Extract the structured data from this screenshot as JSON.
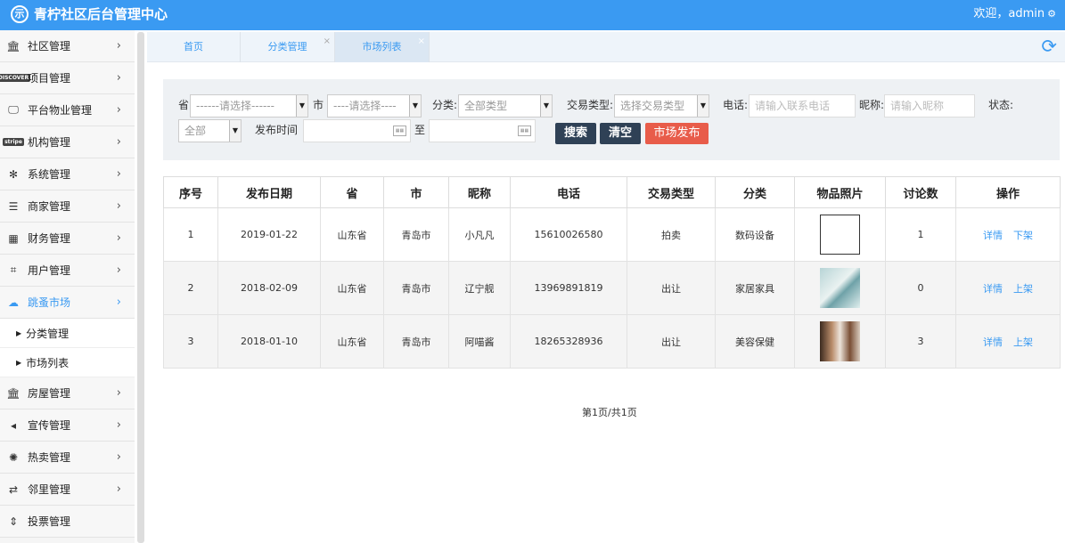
{
  "header": {
    "logo_glyph": "示",
    "title": "青柠社区后台管理中心",
    "welcome": "欢迎，admin",
    "settings_icon": "gear-icon"
  },
  "sidebar": {
    "items": [
      {
        "label": "社区管理",
        "icon": "bank-icon",
        "glyph": "🏛"
      },
      {
        "label": "项目管理",
        "icon": "discover-card-icon",
        "glyph": "DISCOVER"
      },
      {
        "label": "平台物业管理",
        "icon": "monitor-icon",
        "glyph": "🖵"
      },
      {
        "label": "机构管理",
        "icon": "stripe-icon",
        "glyph": "stripe"
      },
      {
        "label": "系统管理",
        "icon": "yelp-icon",
        "glyph": "✻"
      },
      {
        "label": "商家管理",
        "icon": "menu-icon",
        "glyph": "☰"
      },
      {
        "label": "财务管理",
        "icon": "calculator-icon",
        "glyph": "▦"
      },
      {
        "label": "用户管理",
        "icon": "crop-icon",
        "glyph": "⌗"
      },
      {
        "label": "跳蚤市场",
        "icon": "cloud-icon",
        "glyph": "☁",
        "active": true
      },
      {
        "label": "房屋管理",
        "icon": "bank-icon",
        "glyph": "🏛"
      },
      {
        "label": "宣传管理",
        "icon": "volume-icon",
        "glyph": "◂"
      },
      {
        "label": "热卖管理",
        "icon": "sun-icon",
        "glyph": "✺"
      },
      {
        "label": "邻里管理",
        "icon": "retweet-icon",
        "glyph": "⇄"
      },
      {
        "label": "投票管理",
        "icon": "sort-icon",
        "glyph": "⇕"
      }
    ],
    "subitems": [
      {
        "label": "分类管理"
      },
      {
        "label": "市场列表"
      }
    ],
    "accent": "#3a9af2"
  },
  "tabs": [
    {
      "label": "首页",
      "closable": false
    },
    {
      "label": "分类管理",
      "closable": true
    },
    {
      "label": "市场列表",
      "closable": true,
      "active": true
    }
  ],
  "filter": {
    "province_label": "省",
    "province_value": "------请选择------",
    "city_label": "市",
    "city_value": "----请选择----",
    "category_label": "分类:",
    "category_value": "全部类型",
    "trade_label": "交易类型:",
    "trade_value": "选择交易类型",
    "phone_label": "电话:",
    "phone_placeholder": "请输入联系电话",
    "nickname_label": "昵称:",
    "nickname_placeholder": "请输入昵称",
    "status_label": "状态:",
    "status_value": "全部",
    "date_label": "发布时间",
    "date_to": "至",
    "search_btn": "搜索",
    "clear_btn": "清空",
    "publish_btn": "市场发布"
  },
  "table": {
    "columns": [
      "序号",
      "发布日期",
      "省",
      "市",
      "昵称",
      "电话",
      "交易类型",
      "分类",
      "物品照片",
      "讨论数",
      "操作"
    ],
    "rows": [
      {
        "no": "1",
        "date": "2019-01-22",
        "province": "山东省",
        "city": "青岛市",
        "nickname": "小凡凡",
        "phone": "15610026580",
        "trade": "拍卖",
        "category": "数码设备",
        "comments": "1",
        "detail": "详情",
        "toggle": "下架"
      },
      {
        "no": "2",
        "date": "2018-02-09",
        "province": "山东省",
        "city": "青岛市",
        "nickname": "辽宁舰",
        "phone": "13969891819",
        "trade": "出让",
        "category": "家居家具",
        "comments": "0",
        "detail": "详情",
        "toggle": "上架"
      },
      {
        "no": "3",
        "date": "2018-01-10",
        "province": "山东省",
        "city": "青岛市",
        "nickname": "阿喵酱",
        "phone": "18265328936",
        "trade": "出让",
        "category": "美容保健",
        "comments": "3",
        "detail": "详情",
        "toggle": "上架"
      }
    ]
  },
  "pager": {
    "text": "第1页/共1页"
  }
}
